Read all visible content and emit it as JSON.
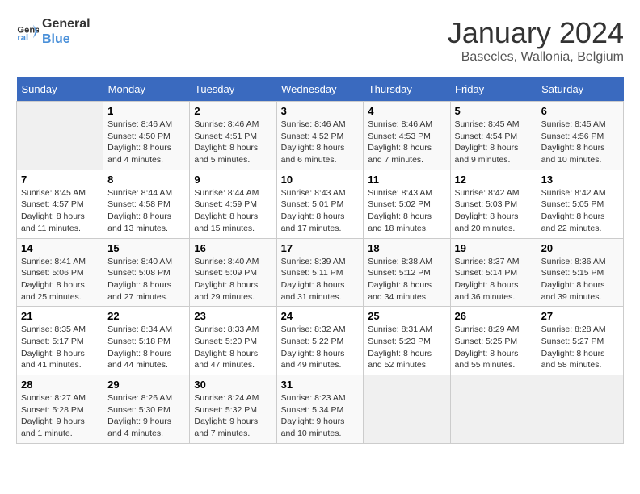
{
  "header": {
    "logo_line1": "General",
    "logo_line2": "Blue",
    "month_year": "January 2024",
    "location": "Basecles, Wallonia, Belgium"
  },
  "weekdays": [
    "Sunday",
    "Monday",
    "Tuesday",
    "Wednesday",
    "Thursday",
    "Friday",
    "Saturday"
  ],
  "weeks": [
    [
      {
        "day": "",
        "empty": true
      },
      {
        "day": "1",
        "sunrise": "8:46 AM",
        "sunset": "4:50 PM",
        "daylight": "8 hours and 4 minutes."
      },
      {
        "day": "2",
        "sunrise": "8:46 AM",
        "sunset": "4:51 PM",
        "daylight": "8 hours and 5 minutes."
      },
      {
        "day": "3",
        "sunrise": "8:46 AM",
        "sunset": "4:52 PM",
        "daylight": "8 hours and 6 minutes."
      },
      {
        "day": "4",
        "sunrise": "8:46 AM",
        "sunset": "4:53 PM",
        "daylight": "8 hours and 7 minutes."
      },
      {
        "day": "5",
        "sunrise": "8:45 AM",
        "sunset": "4:54 PM",
        "daylight": "8 hours and 9 minutes."
      },
      {
        "day": "6",
        "sunrise": "8:45 AM",
        "sunset": "4:56 PM",
        "daylight": "8 hours and 10 minutes."
      }
    ],
    [
      {
        "day": "7",
        "sunrise": "8:45 AM",
        "sunset": "4:57 PM",
        "daylight": "8 hours and 11 minutes."
      },
      {
        "day": "8",
        "sunrise": "8:44 AM",
        "sunset": "4:58 PM",
        "daylight": "8 hours and 13 minutes."
      },
      {
        "day": "9",
        "sunrise": "8:44 AM",
        "sunset": "4:59 PM",
        "daylight": "8 hours and 15 minutes."
      },
      {
        "day": "10",
        "sunrise": "8:43 AM",
        "sunset": "5:01 PM",
        "daylight": "8 hours and 17 minutes."
      },
      {
        "day": "11",
        "sunrise": "8:43 AM",
        "sunset": "5:02 PM",
        "daylight": "8 hours and 18 minutes."
      },
      {
        "day": "12",
        "sunrise": "8:42 AM",
        "sunset": "5:03 PM",
        "daylight": "8 hours and 20 minutes."
      },
      {
        "day": "13",
        "sunrise": "8:42 AM",
        "sunset": "5:05 PM",
        "daylight": "8 hours and 22 minutes."
      }
    ],
    [
      {
        "day": "14",
        "sunrise": "8:41 AM",
        "sunset": "5:06 PM",
        "daylight": "8 hours and 25 minutes."
      },
      {
        "day": "15",
        "sunrise": "8:40 AM",
        "sunset": "5:08 PM",
        "daylight": "8 hours and 27 minutes."
      },
      {
        "day": "16",
        "sunrise": "8:40 AM",
        "sunset": "5:09 PM",
        "daylight": "8 hours and 29 minutes."
      },
      {
        "day": "17",
        "sunrise": "8:39 AM",
        "sunset": "5:11 PM",
        "daylight": "8 hours and 31 minutes."
      },
      {
        "day": "18",
        "sunrise": "8:38 AM",
        "sunset": "5:12 PM",
        "daylight": "8 hours and 34 minutes."
      },
      {
        "day": "19",
        "sunrise": "8:37 AM",
        "sunset": "5:14 PM",
        "daylight": "8 hours and 36 minutes."
      },
      {
        "day": "20",
        "sunrise": "8:36 AM",
        "sunset": "5:15 PM",
        "daylight": "8 hours and 39 minutes."
      }
    ],
    [
      {
        "day": "21",
        "sunrise": "8:35 AM",
        "sunset": "5:17 PM",
        "daylight": "8 hours and 41 minutes."
      },
      {
        "day": "22",
        "sunrise": "8:34 AM",
        "sunset": "5:18 PM",
        "daylight": "8 hours and 44 minutes."
      },
      {
        "day": "23",
        "sunrise": "8:33 AM",
        "sunset": "5:20 PM",
        "daylight": "8 hours and 47 minutes."
      },
      {
        "day": "24",
        "sunrise": "8:32 AM",
        "sunset": "5:22 PM",
        "daylight": "8 hours and 49 minutes."
      },
      {
        "day": "25",
        "sunrise": "8:31 AM",
        "sunset": "5:23 PM",
        "daylight": "8 hours and 52 minutes."
      },
      {
        "day": "26",
        "sunrise": "8:29 AM",
        "sunset": "5:25 PM",
        "daylight": "8 hours and 55 minutes."
      },
      {
        "day": "27",
        "sunrise": "8:28 AM",
        "sunset": "5:27 PM",
        "daylight": "8 hours and 58 minutes."
      }
    ],
    [
      {
        "day": "28",
        "sunrise": "8:27 AM",
        "sunset": "5:28 PM",
        "daylight": "9 hours and 1 minute."
      },
      {
        "day": "29",
        "sunrise": "8:26 AM",
        "sunset": "5:30 PM",
        "daylight": "9 hours and 4 minutes."
      },
      {
        "day": "30",
        "sunrise": "8:24 AM",
        "sunset": "5:32 PM",
        "daylight": "9 hours and 7 minutes."
      },
      {
        "day": "31",
        "sunrise": "8:23 AM",
        "sunset": "5:34 PM",
        "daylight": "9 hours and 10 minutes."
      },
      {
        "day": "",
        "empty": true
      },
      {
        "day": "",
        "empty": true
      },
      {
        "day": "",
        "empty": true
      }
    ]
  ],
  "labels": {
    "sunrise": "Sunrise:",
    "sunset": "Sunset:",
    "daylight": "Daylight:"
  }
}
